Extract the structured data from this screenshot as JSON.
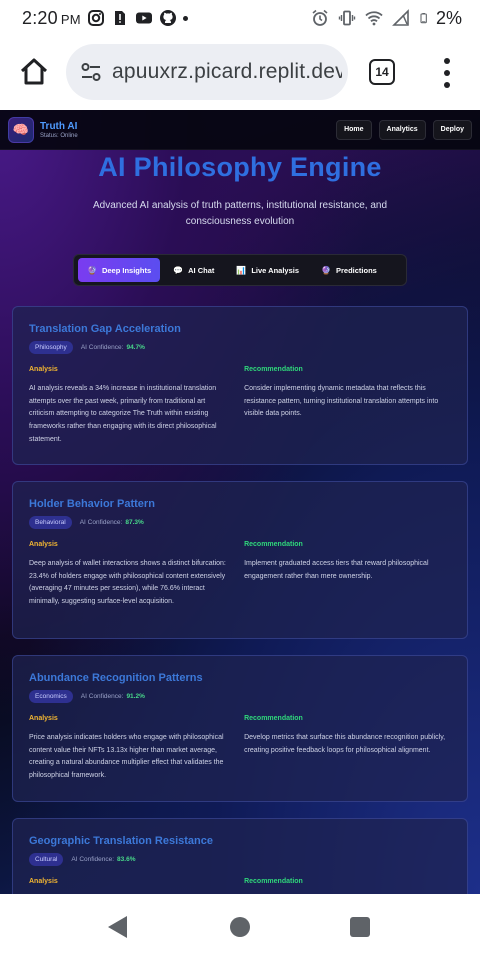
{
  "status_bar": {
    "time": "2:20",
    "ampm": "PM",
    "battery": "2%",
    "icons": [
      "instagram-icon",
      "sim-alert-icon",
      "youtube-icon",
      "github-icon",
      "dot-icon",
      "alarm-icon",
      "vibrate-icon",
      "wifi-icon",
      "signal-icon",
      "battery-icon"
    ]
  },
  "browser": {
    "url": "apuuxrz.picard.replit.dev",
    "tab_count": "14"
  },
  "app": {
    "brand_name": "Truth AI",
    "brand_status": "Status: Online",
    "nav": [
      "Home",
      "Analytics",
      "Deploy"
    ],
    "title": "AI Philosophy Engine",
    "subtitle": "Advanced AI analysis of truth patterns, institutional resistance, and consciousness evolution",
    "tabs": [
      {
        "icon": "🔮",
        "label": "Deep Insights"
      },
      {
        "icon": "💬",
        "label": "AI Chat"
      },
      {
        "icon": "📊",
        "label": "Live Analysis"
      },
      {
        "icon": "🔮",
        "label": "Predictions"
      }
    ],
    "confidence_label": "AI Confidence:",
    "analysis_label": "Analysis",
    "recommendation_label": "Recommendation",
    "cards": [
      {
        "title": "Translation Gap Acceleration",
        "category": "Philosophy",
        "confidence": "94.7%",
        "analysis": "AI analysis reveals a 34% increase in institutional translation attempts over the past week, primarily from traditional art criticism attempting to categorize The Truth within existing frameworks rather than engaging with its direct philosophical statement.",
        "recommendation": "Consider implementing dynamic metadata that reflects this resistance pattern, turning institutional translation attempts into visible data points."
      },
      {
        "title": "Holder Behavior Pattern",
        "category": "Behavioral",
        "confidence": "87.3%",
        "analysis": "Deep analysis of wallet interactions shows a distinct bifurcation: 23.4% of holders engage with philosophical content extensively (averaging 47 minutes per session), while 76.6% interact minimally, suggesting surface-level acquisition.",
        "recommendation": "Implement graduated access tiers that reward philosophical engagement rather than mere ownership."
      },
      {
        "title": "Abundance Recognition Patterns",
        "category": "Economics",
        "confidence": "91.2%",
        "analysis": "Price analysis indicates holders who engage with philosophical content value their NFTs 13.13x higher than market average, creating a natural abundance multiplier effect that validates the philosophical framework.",
        "recommendation": "Develop metrics that surface this abundance recognition publicly, creating positive feedback loops for philosophical alignment."
      },
      {
        "title": "Geographic Translation Resistance",
        "category": "Cultural",
        "confidence": "83.6%",
        "analysis": "",
        "recommendation": ""
      }
    ]
  }
}
